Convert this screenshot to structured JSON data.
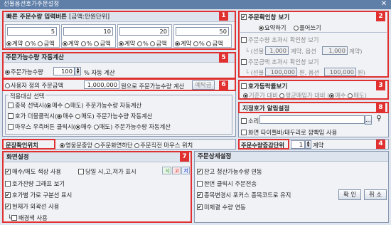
{
  "window": {
    "title": "선물옵션호가주문설정",
    "close": "✕"
  },
  "quick_order": {
    "title": "빠른 주문수량 입력버튼",
    "unit": "[금액:만원단위]",
    "slots": [
      {
        "value": "5"
      },
      {
        "value": "10"
      },
      {
        "value": "20"
      },
      {
        "value": "50"
      }
    ],
    "opt_count": "계약",
    "opt_pct": "%",
    "opt_amount": "금액"
  },
  "order_possible": {
    "title": "주문가능수량 자동계산",
    "opt1": "주문가능수량",
    "value1": "100",
    "unit1": "% 자동 계산",
    "opt2": "사용자 정의 주문금액",
    "value2": "1,000,000",
    "unit2": "원으로 주문가능수량 계산",
    "deposit_btn": "예탁금"
  },
  "apply_target": {
    "title": "적용대상 선택",
    "rows": [
      {
        "label": "종목 선택시",
        "o1": "매수",
        "o2": "매도",
        "suffix": "주문가능수량 자동계산"
      },
      {
        "label": "호가 더블클릭시",
        "o1": "매수",
        "o2": "매도",
        "suffix": "주문가능수량 자동계산"
      },
      {
        "label": "마우스 우측버튼 클릭시",
        "o1": "매수",
        "o2": "매도",
        "suffix": "주문가능수량 자동계산"
      }
    ]
  },
  "confirm": {
    "title": "주문확인창 보기",
    "opt_summary": "요약하기",
    "opt_full": "풀어쓰기",
    "exceed_qty": "주문수량 초과시 확인창 보기",
    "futures_label": "(선물",
    "futures_qty": "1,000",
    "futures_unit": "계약, 옵션",
    "options_qty": "1,000",
    "options_unit": "계약)",
    "exceed_amt": "주문금액 초과시 확인창 보기",
    "futures_amt": "100,000",
    "amt_mid": "원, 옵션",
    "options_amt": "100,000",
    "amt_end": "원)"
  },
  "rate_view": {
    "title": "호가등락률보기",
    "opt1": "기준가 대비",
    "opt2": "평균매입가 대비",
    "opt3": "매수",
    "opt4": "매도"
  },
  "alert": {
    "title": "지정호가 알림설정",
    "sound": "소리",
    "browse_btn": "...",
    "popup": "화면 타이틀바/태두리로 깜빡임 사용"
  },
  "sentence_pos": {
    "label": "문장확인위치",
    "o1": "영웅문중앙",
    "o2": "주문화면하단",
    "o3": "주문직전 마우스 위치"
  },
  "qty_step": {
    "label": "주문수량증감단위",
    "value": "1",
    "unit": "계약"
  },
  "screen": {
    "title": "화면설정",
    "buysell_color": "매수/매도 색상 사용",
    "daily": "당일 시,고,저가 표시",
    "hi_si": "시",
    "hi_go": "고",
    "hi_jeo": "저",
    "remain_graph": "호가잔량 그래프 보기",
    "separator": "호가별 가로 구분선 표시",
    "border": "현재가 외곽선 사용",
    "bgcolor": "배경색 사용"
  },
  "detail": {
    "title": "주문상세설정",
    "c1": "잔고 청산가능수량 연동",
    "c2": "한번 클릭시 주문전송",
    "c3": "종목변경시 포커스 종목코드로 유지",
    "c4": "미체결 수량 연동",
    "ok": "확 인",
    "cancel": "취 소"
  },
  "badges": [
    "1",
    "2",
    "3",
    "4",
    "5",
    "6",
    "7",
    "8"
  ],
  "colors": {
    "badge": "#e03030",
    "title_bar": "#5f7fa8"
  }
}
